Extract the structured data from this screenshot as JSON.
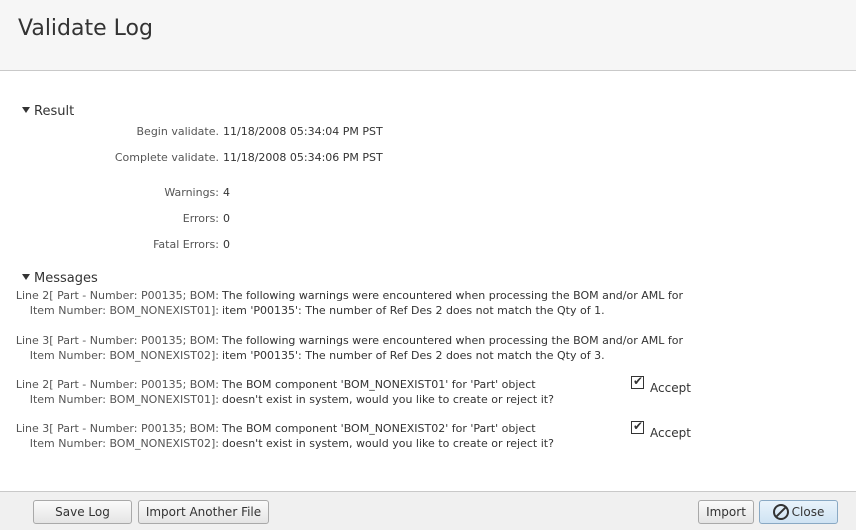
{
  "page": {
    "title": "Validate Log"
  },
  "result": {
    "heading": "Result",
    "rows": [
      {
        "label": "Begin validate.",
        "value": "11/18/2008 05:34:04 PM PST"
      },
      {
        "label": "Complete validate.",
        "value": "11/18/2008 05:34:06 PM PST"
      },
      {
        "label": "Warnings:",
        "value": "4"
      },
      {
        "label": "Errors:",
        "value": "0"
      },
      {
        "label": "Fatal Errors:",
        "value": "0"
      }
    ]
  },
  "messages": {
    "heading": "Messages",
    "items": [
      {
        "label1": "Line 2[ Part - Number: P00135; BOM:",
        "label2": "Item Number: BOM_NONEXIST01]:",
        "text1": "The following warnings were encountered when processing the BOM and/or AML for",
        "text2": "item 'P00135': The number of Ref Des 2 does not match the Qty of 1."
      },
      {
        "label1": "Line 3[ Part - Number: P00135; BOM:",
        "label2": "Item Number: BOM_NONEXIST02]:",
        "text1": "The following warnings were encountered when processing the BOM and/or AML for",
        "text2": "item 'P00135': The number of Ref Des 2 does not match the Qty of 3."
      },
      {
        "label1": "Line 2[ Part - Number: P00135; BOM:",
        "label2": "Item Number: BOM_NONEXIST01]:",
        "text1": "The BOM component 'BOM_NONEXIST01' for 'Part' object",
        "text2": "doesn't exist in system, would you like to create or reject it?",
        "accept_label": "Accept",
        "accept_checked": true
      },
      {
        "label1": "Line 3[ Part - Number: P00135; BOM:",
        "label2": "Item Number: BOM_NONEXIST02]:",
        "text1": "The BOM component 'BOM_NONEXIST02' for 'Part' object",
        "text2": "doesn't exist in system, would you like to create or reject it?",
        "accept_label": "Accept",
        "accept_checked": true
      }
    ]
  },
  "footer": {
    "save_log": "Save Log",
    "import_another": "Import Another File",
    "import": "Import",
    "close": "Close"
  }
}
